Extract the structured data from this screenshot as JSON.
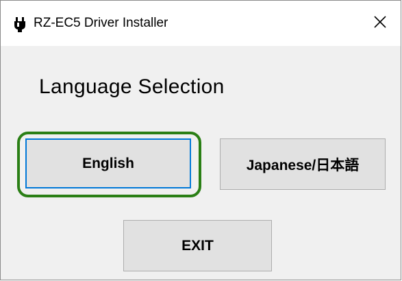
{
  "window": {
    "title": "RZ-EC5 Driver Installer",
    "close_glyph": "✕"
  },
  "icons": {
    "app_icon": "usb-plug-icon",
    "close_icon": "close-icon"
  },
  "main": {
    "heading": "Language Selection",
    "buttons": {
      "english": "English",
      "japanese": "Japanese/日本語",
      "exit": "EXIT"
    }
  },
  "colors": {
    "focus_highlight": "#2a7f15",
    "button_focus_border": "#0078d7",
    "button_bg": "#e1e1e1",
    "window_bg": "#f0f0f0"
  }
}
